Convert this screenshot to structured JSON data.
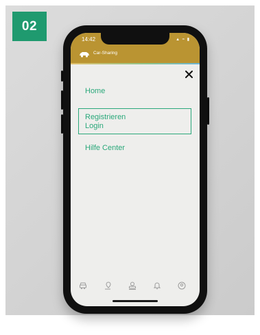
{
  "step": {
    "label": "02"
  },
  "status_bar": {
    "time": "14:42",
    "icons": "▲ ≈ ▮"
  },
  "header": {
    "title": "Car-Sharing",
    "logo_icon": "car-icon"
  },
  "menu": {
    "close_icon": "close-icon",
    "home": "Home",
    "register": "Registrieren",
    "login": "Login",
    "help": "Hilfe Center"
  },
  "tabbar": {
    "icons": [
      "car-tab-icon",
      "pin-tab-icon",
      "car-search-tab-icon",
      "bell-tab-icon",
      "profile-tab-icon"
    ]
  },
  "colors": {
    "brand_gold": "#ba9432",
    "accent_green": "#2aa87a",
    "badge_green": "#1f9a6f",
    "screen_bg": "#eeeeec"
  }
}
